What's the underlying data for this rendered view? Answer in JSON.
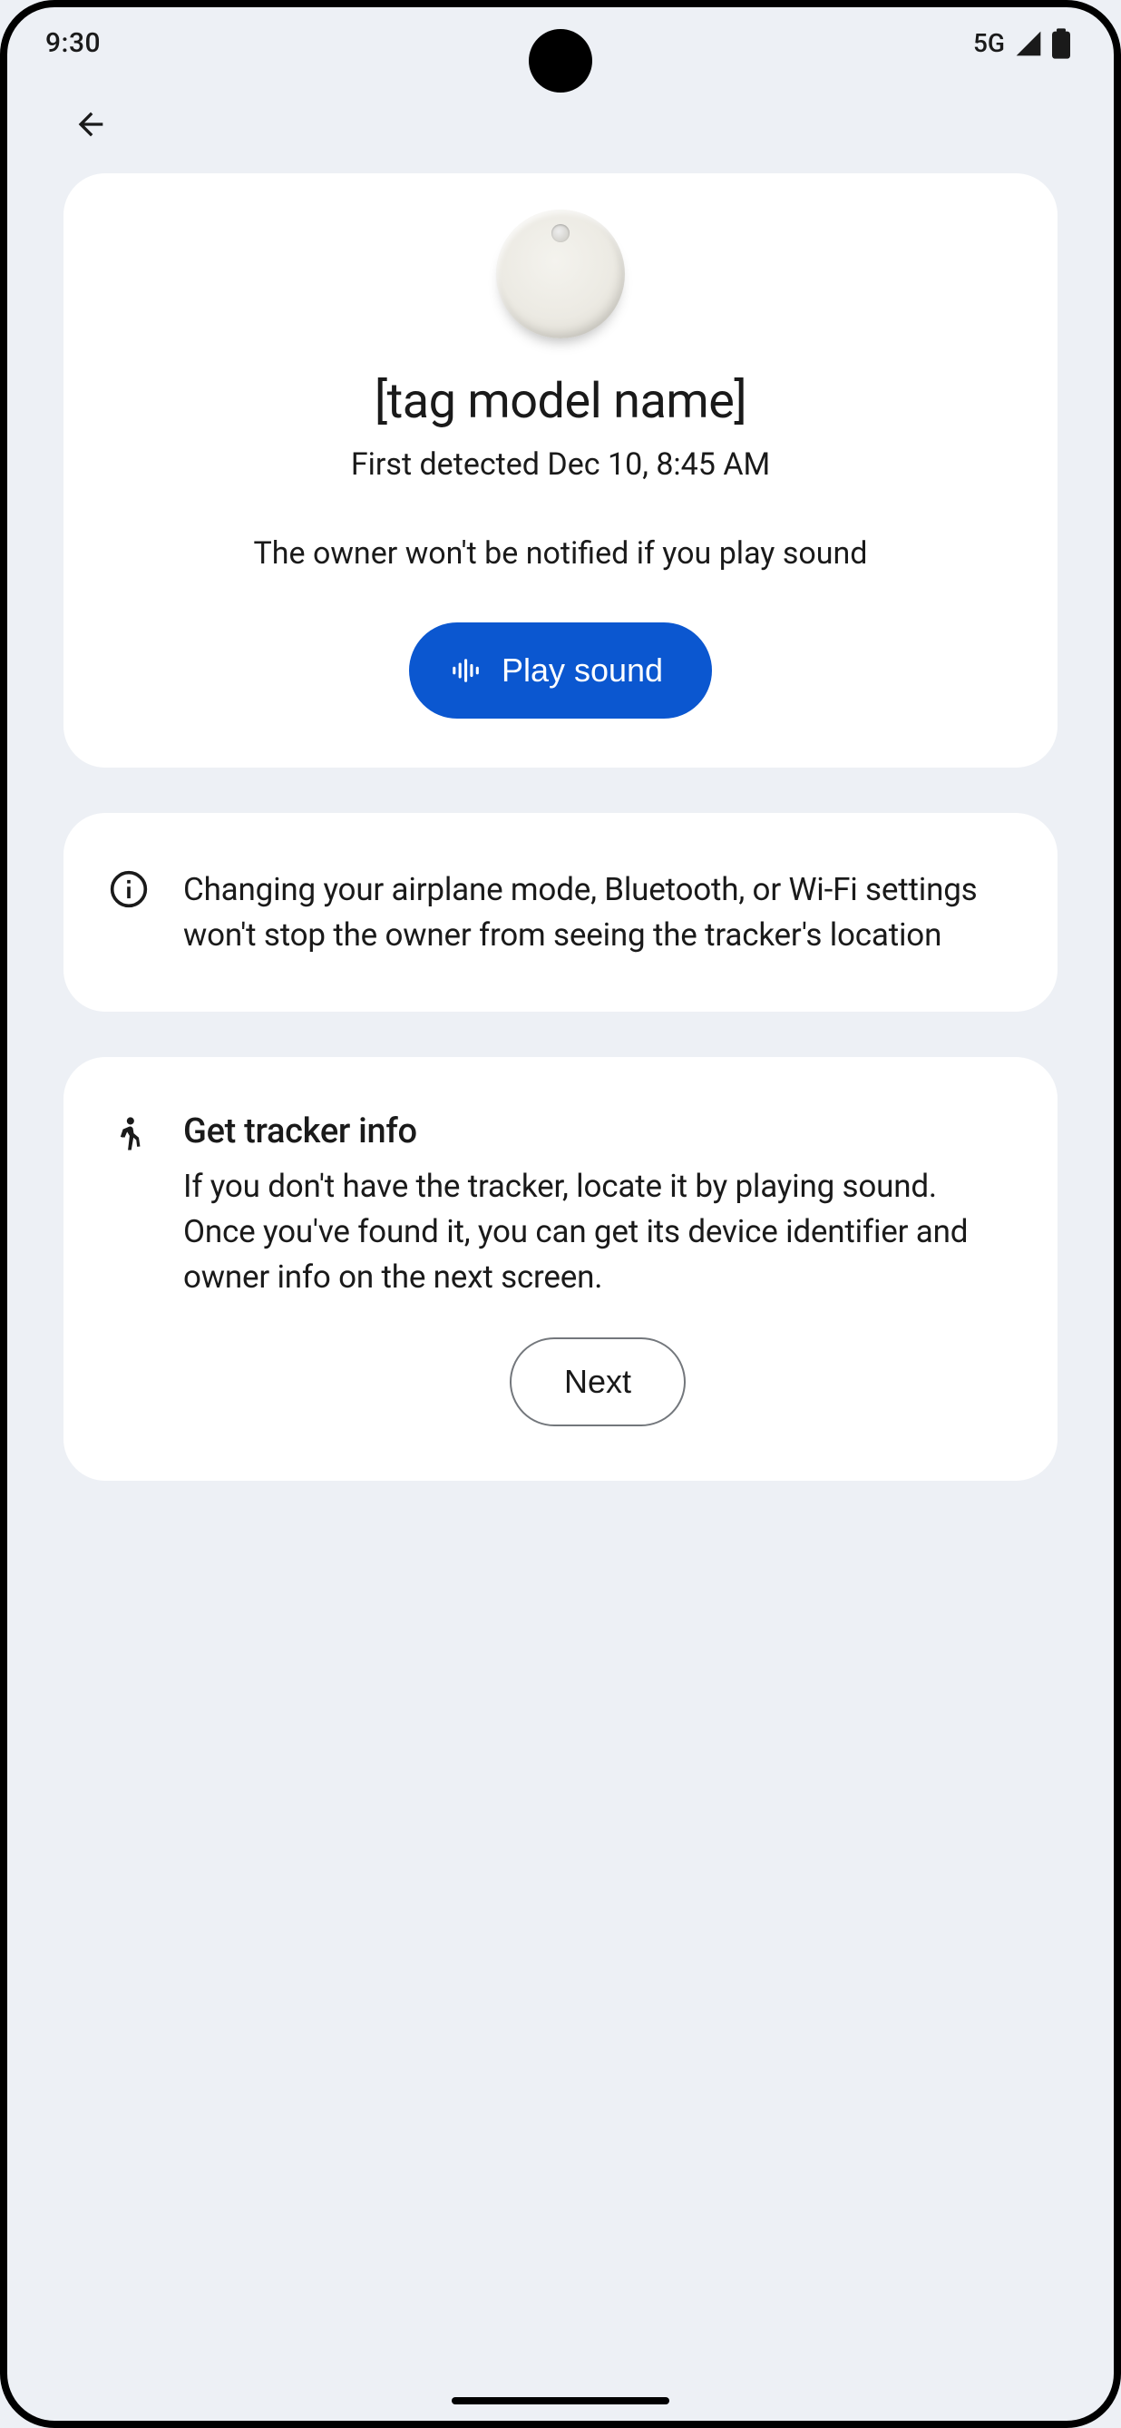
{
  "status": {
    "time": "9:30",
    "network": "5G"
  },
  "hero": {
    "title": "[tag model name]",
    "detected": "First detected Dec 10, 8:45 AM",
    "notice": "The owner won't be notified if you play sound",
    "playSoundLabel": "Play sound"
  },
  "infoCard": {
    "text": "Changing your airplane mode, Bluetooth, or Wi-Fi settings won't stop the owner from seeing the tracker's location"
  },
  "trackerCard": {
    "title": "Get tracker info",
    "body": "If you don't have the tracker, locate it by playing sound. Once you've found it, you can get its device identifier and owner info on the next screen.",
    "nextLabel": "Next"
  }
}
